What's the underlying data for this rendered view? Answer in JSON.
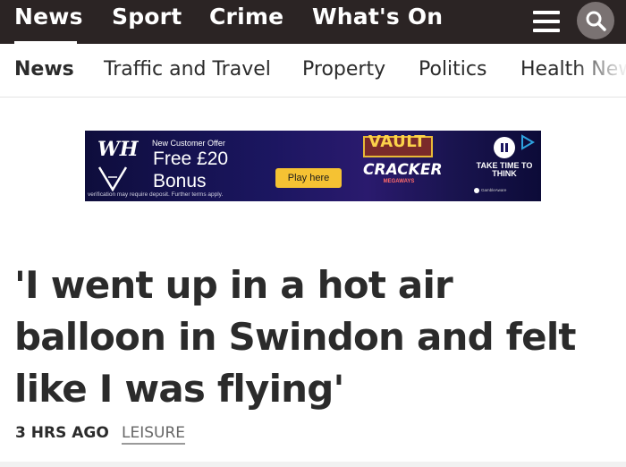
{
  "top_nav": {
    "items": [
      "News",
      "Sport",
      "Crime",
      "What's On"
    ],
    "active": "News",
    "menu_icon": "hamburger-menu-icon",
    "search_icon": "search-icon",
    "background": "#2b2424"
  },
  "sub_nav": {
    "items": [
      "News",
      "Traffic and Travel",
      "Property",
      "Politics",
      "Health News"
    ],
    "active": "News"
  },
  "ad": {
    "brand_logo": "WH",
    "offer_heading": "New Customer Offer",
    "offer_line1": "Free £20",
    "offer_line2": "Bonus",
    "terms": "verification may require deposit. Further terms apply.",
    "cta": "Play here",
    "game_title_top": "VAULT",
    "game_title_bottom": "CRACKER",
    "game_tag": "MEGAWAYS",
    "take_time": "TAKE TIME TO THINK",
    "gamble_aware": "GambleAware"
  },
  "article": {
    "headline": "'I went up in a hot air balloon in Swindon and felt like I was flying'",
    "time": "3 HRS AGO",
    "category": "LEISURE"
  }
}
